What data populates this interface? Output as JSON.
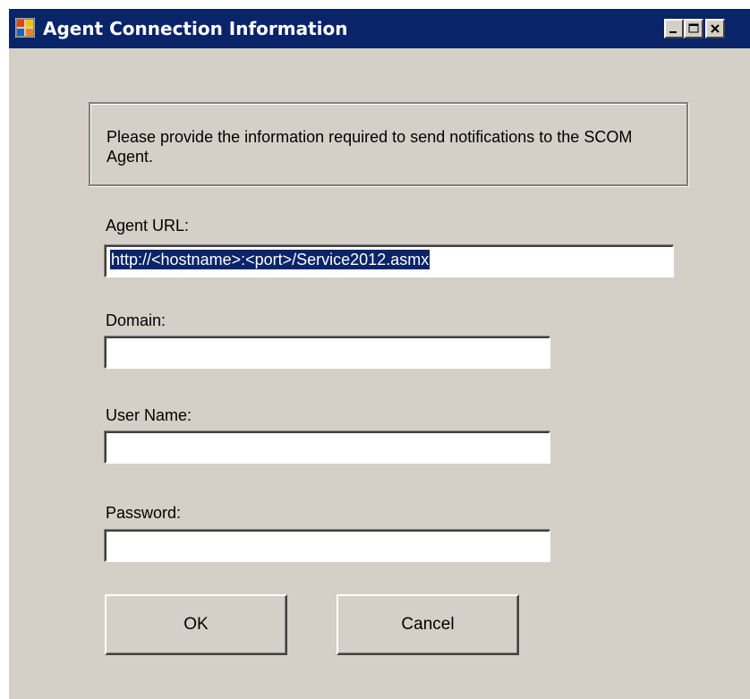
{
  "window": {
    "title": "Agent Connection Information",
    "icon": "application-icon",
    "controls": [
      "minimize-icon",
      "maximize-icon",
      "close-icon"
    ]
  },
  "info": {
    "text": "Please provide the information required to send notifications to the SCOM Agent."
  },
  "form": {
    "agent_url": {
      "label": "Agent URL:",
      "value": "http://<hostname>:<port>/Service2012.asmx",
      "selected": true
    },
    "domain": {
      "label": "Domain:",
      "value": ""
    },
    "user_name": {
      "label": "User Name:",
      "value": ""
    },
    "password": {
      "label": "Password:",
      "value": ""
    }
  },
  "buttons": {
    "ok": "OK",
    "cancel": "Cancel"
  },
  "colors": {
    "titlebar": "#0a246a",
    "face": "#d4d0c8",
    "selection": "#0a246a"
  }
}
